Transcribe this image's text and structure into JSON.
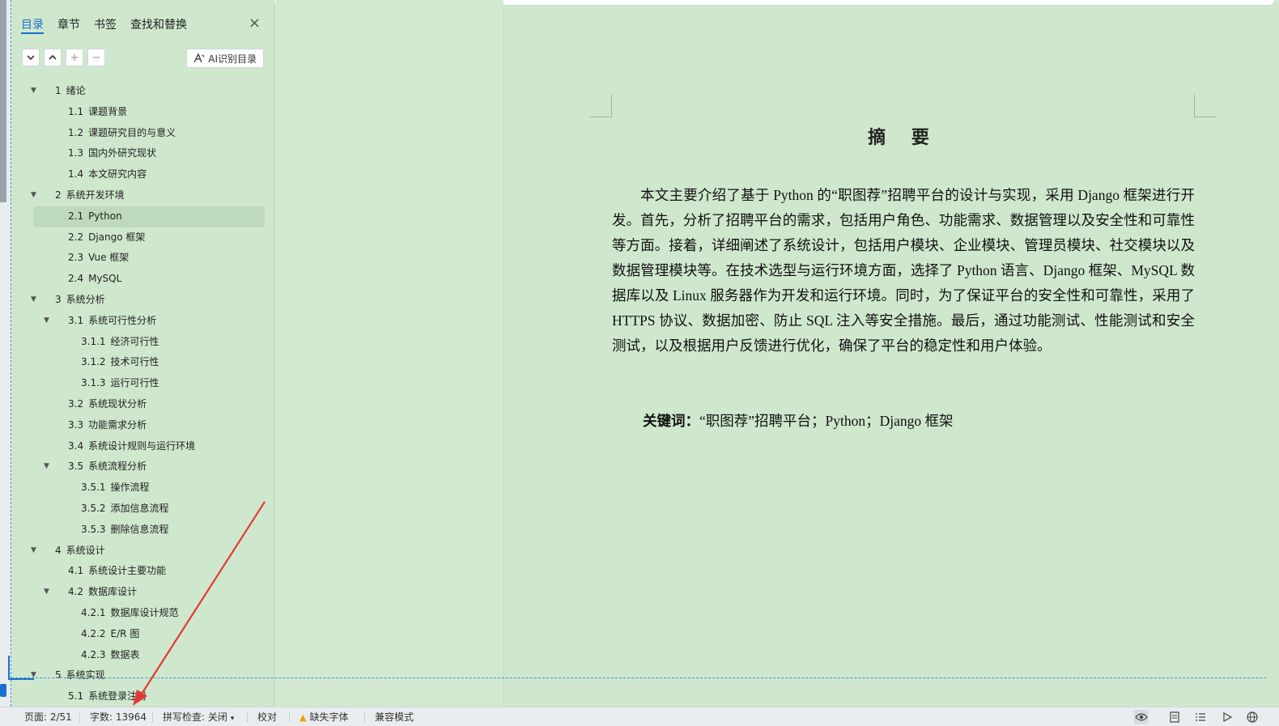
{
  "nav": {
    "tabs": [
      {
        "label": "目录",
        "active": true
      },
      {
        "label": "章节"
      },
      {
        "label": "书签"
      },
      {
        "label": "查找和替换"
      }
    ],
    "close_label": "×",
    "ai_button_label": "AI识别目录",
    "toc": [
      {
        "num": "1",
        "text": "绪论",
        "level": 1,
        "expanded": true
      },
      {
        "num": "1.1",
        "text": "课题背景",
        "level": 2
      },
      {
        "num": "1.2",
        "text": "课题研究目的与意义",
        "level": 2
      },
      {
        "num": "1.3",
        "text": "国内外研究现状",
        "level": 2
      },
      {
        "num": "1.4",
        "text": "本文研究内容",
        "level": 2
      },
      {
        "num": "2",
        "text": "系统开发环境",
        "level": 1,
        "expanded": true
      },
      {
        "num": "2.1",
        "text": "Python",
        "level": 2,
        "selected": true
      },
      {
        "num": "2.2",
        "text": "Django 框架",
        "level": 2
      },
      {
        "num": "2.3",
        "text": "Vue 框架",
        "level": 2
      },
      {
        "num": "2.4",
        "text": "MySQL",
        "level": 2
      },
      {
        "num": "3",
        "text": "系统分析",
        "level": 1,
        "expanded": true
      },
      {
        "num": "3.1",
        "text": "系统可行性分析",
        "level": 2,
        "expanded": true
      },
      {
        "num": "3.1.1",
        "text": "经济可行性",
        "level": 3
      },
      {
        "num": "3.1.2",
        "text": "技术可行性",
        "level": 3
      },
      {
        "num": "3.1.3",
        "text": "运行可行性",
        "level": 3
      },
      {
        "num": "3.2",
        "text": "系统现状分析",
        "level": 2
      },
      {
        "num": "3.3",
        "text": "功能需求分析",
        "level": 2
      },
      {
        "num": "3.4",
        "text": "系统设计规则与运行环境",
        "level": 2
      },
      {
        "num": "3.5",
        "text": "系统流程分析",
        "level": 2,
        "expanded": true
      },
      {
        "num": "3.5.1",
        "text": "操作流程",
        "level": 3
      },
      {
        "num": "3.5.2",
        "text": "添加信息流程",
        "level": 3
      },
      {
        "num": "3.5.3",
        "text": "删除信息流程",
        "level": 3
      },
      {
        "num": "4",
        "text": "系统设计",
        "level": 1,
        "expanded": true
      },
      {
        "num": "4.1",
        "text": "系统设计主要功能",
        "level": 2
      },
      {
        "num": "4.2",
        "text": "数据库设计",
        "level": 2,
        "expanded": true
      },
      {
        "num": "4.2.1",
        "text": "数据库设计规范",
        "level": 3
      },
      {
        "num": "4.2.2",
        "text": "E/R 图",
        "level": 3
      },
      {
        "num": "4.2.3",
        "text": "数据表",
        "level": 3
      },
      {
        "num": "5",
        "text": "系统实现",
        "level": 1,
        "expanded": true
      },
      {
        "num": "5.1",
        "text": "系统登录注册",
        "level": 2
      }
    ]
  },
  "document": {
    "title": "摘 要",
    "body": "本文主要介绍了基于 Python 的“职图荐”招聘平台的设计与实现，采用 Django 框架进行开发。首先，分析了招聘平台的需求，包括用户角色、功能需求、数据管理以及安全性和可靠性等方面。接着，详细阐述了系统设计，包括用户模块、企业模块、管理员模块、社交模块以及数据管理模块等。在技术选型与运行环境方面，选择了 Python 语言、Django 框架、MySQL 数据库以及 Linux 服务器作为开发和运行环境。同时，为了保证平台的安全性和可靠性，采用了 HTTPS 协议、数据加密、防止 SQL 注入等安全措施。最后，通过功能测试、性能测试和安全测试，以及根据用户反馈进行优化，确保了平台的稳定性和用户体验。",
    "keywords_label": "关键词：",
    "keywords": "“职图荐”招聘平台；Python；Django 框架"
  },
  "status": {
    "page": "页面: 2/51",
    "words": "字数: 13964",
    "spell": "拼写检查: 关闭",
    "proof": "校对",
    "missing_font": "缺失字体",
    "compat": "兼容模式"
  },
  "colors": {
    "accent": "#1a6fd1",
    "background": "#cfe8cd",
    "annotation_arrow": "#e53935"
  }
}
